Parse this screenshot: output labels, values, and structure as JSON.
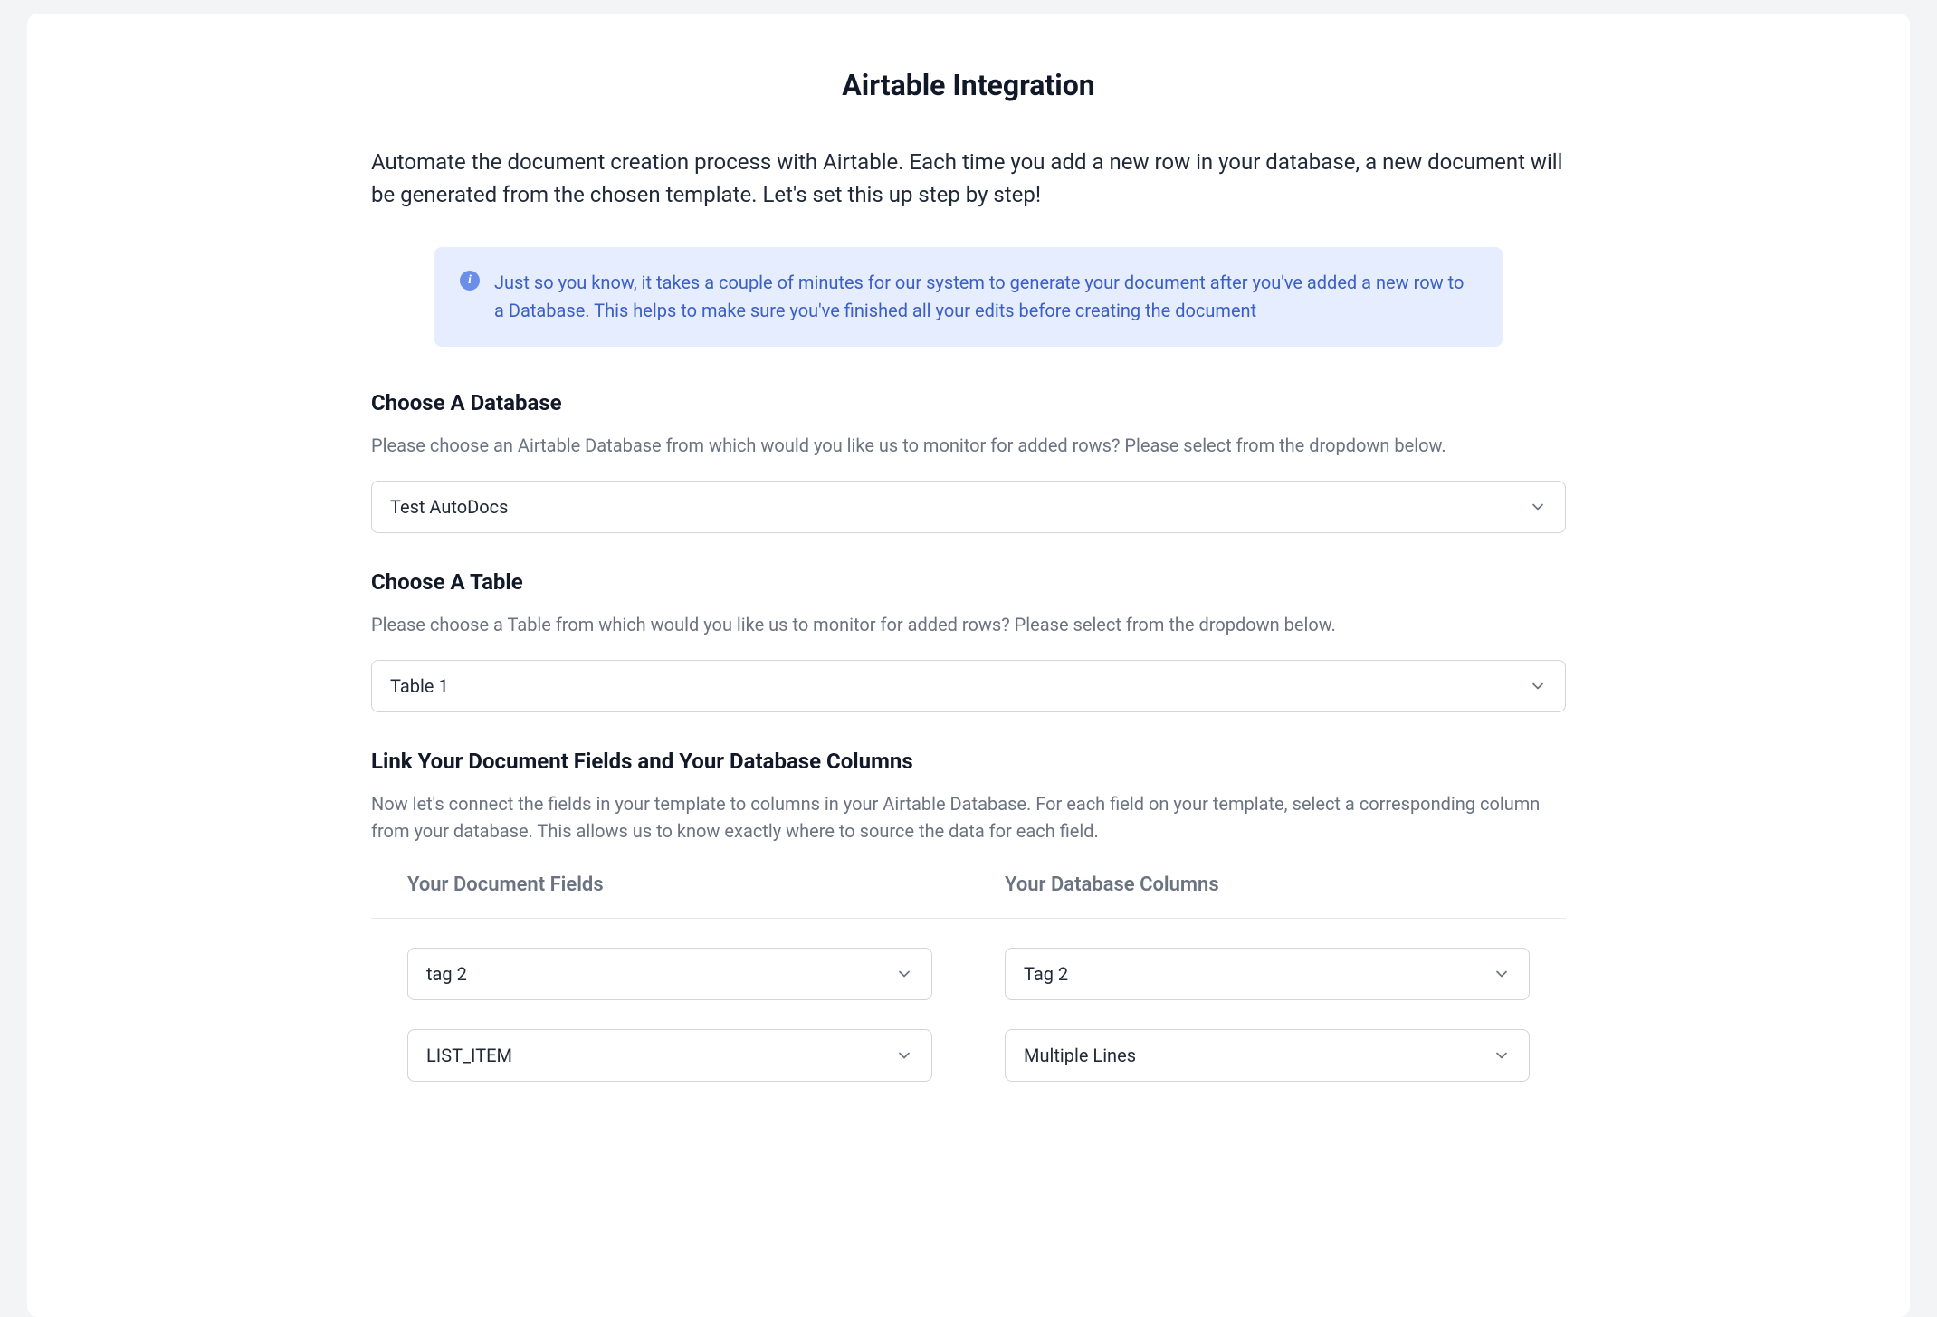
{
  "title": "Airtable Integration",
  "intro": "Automate the document creation process with Airtable. Each time you add a new row in your database, a new document will be generated from the chosen template. Let's set this up step by step!",
  "info_notice": "Just so you know, it takes a couple of minutes for our system to generate your document after you've added a new row to a Database. This helps to make sure you've finished all your edits before creating the document",
  "sections": {
    "database": {
      "title": "Choose A Database",
      "description": "Please choose an Airtable Database from which would you like us to monitor for added rows? Please select from the dropdown below.",
      "selected": "Test AutoDocs"
    },
    "table": {
      "title": "Choose A Table",
      "description": "Please choose a Table from which would you like us to monitor for added rows? Please select from the dropdown below.",
      "selected": "Table 1"
    },
    "link": {
      "title": "Link Your Document Fields and Your Database Columns",
      "description": "Now let's connect the fields in your template to columns in your Airtable Database. For each field on your template, select a corresponding column from your database. This allows us to know exactly where to source the data for each field."
    }
  },
  "mapping": {
    "headers": {
      "left": "Your Document Fields",
      "right": "Your Database Columns"
    },
    "rows": [
      {
        "field": "tag 2",
        "column": "Tag 2"
      },
      {
        "field": "LIST_ITEM",
        "column": "Multiple Lines"
      }
    ]
  }
}
